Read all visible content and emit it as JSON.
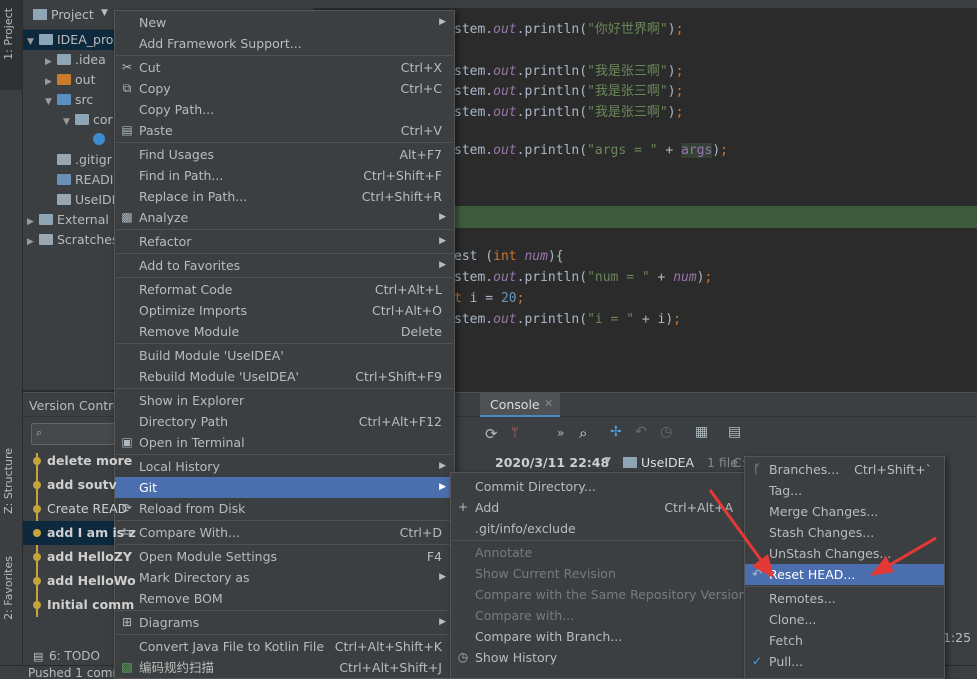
{
  "left_strip": {
    "project_tab": "1: Project",
    "structure_tab": "Z: Structure",
    "favorites_tab": "2: Favorites"
  },
  "project_panel": {
    "title": "Project",
    "tree": [
      {
        "label": "IDEA_pro",
        "depth": 0,
        "expanded": true,
        "type": "module"
      },
      {
        "label": ".idea",
        "depth": 1,
        "expanded": false,
        "type": "folder"
      },
      {
        "label": "out",
        "depth": 1,
        "expanded": false,
        "type": "folder-out"
      },
      {
        "label": "src",
        "depth": 1,
        "expanded": true,
        "type": "folder-src"
      },
      {
        "label": "cor",
        "depth": 2,
        "expanded": true,
        "type": "package"
      },
      {
        "label": "",
        "depth": 3,
        "type": "class"
      },
      {
        "label": ".gitigr",
        "depth": 1,
        "type": "file"
      },
      {
        "label": "READI",
        "depth": 1,
        "type": "md"
      },
      {
        "label": "UseIDE",
        "depth": 1,
        "type": "iml"
      },
      {
        "label": "External L",
        "depth": 0,
        "expanded": false,
        "type": "lib"
      },
      {
        "label": "Scratches",
        "depth": 0,
        "expanded": false,
        "type": "scratch"
      }
    ]
  },
  "editor": {
    "lines": [
      {
        "code": "stem.out.println(\"你好世界啊\");",
        "str": "\"你好世界啊\""
      },
      {
        "code": "stem.out.println(\"我是张三啊\");",
        "str": "\"我是张三啊\""
      },
      {
        "code": "stem.out.println(\"我是张三啊\");",
        "str": "\"我是张三啊\""
      },
      {
        "code": "stem.out.println(\"我是张三啊\");",
        "str": "\"我是张三啊\""
      },
      {
        "code": "stem.out.println(\"args = \" + args);",
        "str": "\"args = \""
      },
      {
        "code": "est (int num){"
      },
      {
        "code": "stem.out.println(\"num = \" + num);",
        "str": "\"num = \""
      },
      {
        "code": "t i = 20;"
      },
      {
        "code": "stem.out.println(\"i = \" + i);",
        "str": "\"i = \""
      }
    ]
  },
  "bottom_panel": {
    "version_control_tab": "Version Contro",
    "console_tab": "Console",
    "search_placeholder": "Q-",
    "date": "2020/3/11 22:48",
    "branch": "UseIDEA",
    "file_count": "1 file",
    "path_hint": "C:\\Wo",
    "time_hint": "1:25",
    "commits": [
      "delete more",
      "add soutv",
      "Create READ",
      "add I am is z",
      "add HelloZY",
      "add HelloWo",
      "Initial comm"
    ],
    "todo_tab": "6: TODO",
    "status": "Pushed 1 comm"
  },
  "context_menu": {
    "items": [
      {
        "label": "New",
        "submenu": true
      },
      {
        "label": "Add Framework Support..."
      },
      {
        "sep": true
      },
      {
        "label": "Cut",
        "shortcut": "Ctrl+X",
        "icon": "cut-icon"
      },
      {
        "label": "Copy",
        "shortcut": "Ctrl+C",
        "icon": "copy-icon"
      },
      {
        "label": "Copy Path..."
      },
      {
        "label": "Paste",
        "shortcut": "Ctrl+V",
        "icon": "paste-icon"
      },
      {
        "sep": true
      },
      {
        "label": "Find Usages",
        "shortcut": "Alt+F7"
      },
      {
        "label": "Find in Path...",
        "shortcut": "Ctrl+Shift+F"
      },
      {
        "label": "Replace in Path...",
        "shortcut": "Ctrl+Shift+R"
      },
      {
        "label": "Analyze",
        "submenu": true,
        "icon": "analyze-icon"
      },
      {
        "sep": true
      },
      {
        "label": "Refactor",
        "submenu": true
      },
      {
        "sep": true
      },
      {
        "label": "Add to Favorites",
        "submenu": true
      },
      {
        "sep": true
      },
      {
        "label": "Reformat Code",
        "shortcut": "Ctrl+Alt+L"
      },
      {
        "label": "Optimize Imports",
        "shortcut": "Ctrl+Alt+O"
      },
      {
        "label": "Remove Module",
        "shortcut": "Delete"
      },
      {
        "sep": true
      },
      {
        "label": "Build Module 'UseIDEA'"
      },
      {
        "label": "Rebuild Module 'UseIDEA'",
        "shortcut": "Ctrl+Shift+F9"
      },
      {
        "sep": true
      },
      {
        "label": "Show in Explorer"
      },
      {
        "label": "Directory Path",
        "shortcut": "Ctrl+Alt+F12"
      },
      {
        "label": "Open in Terminal",
        "icon": "terminal-icon"
      },
      {
        "sep": true
      },
      {
        "label": "Local History",
        "submenu": true
      },
      {
        "label": "Git",
        "submenu": true,
        "active": true
      },
      {
        "label": "Reload from Disk",
        "icon": "reload-icon"
      },
      {
        "sep": true
      },
      {
        "label": "Compare With...",
        "shortcut": "Ctrl+D",
        "icon": "compare-icon"
      },
      {
        "sep": true
      },
      {
        "label": "Open Module Settings",
        "shortcut": "F4"
      },
      {
        "label": "Mark Directory as",
        "submenu": true
      },
      {
        "label": "Remove BOM"
      },
      {
        "sep": true
      },
      {
        "label": "Diagrams",
        "submenu": true,
        "icon": "diagram-icon"
      },
      {
        "sep": true
      },
      {
        "label": "Convert Java File to Kotlin File",
        "shortcut": "Ctrl+Alt+Shift+K"
      },
      {
        "label": "编码规约扫描",
        "shortcut": "Ctrl+Alt+Shift+J",
        "icon": "scan-icon"
      }
    ]
  },
  "git_menu": {
    "items": [
      {
        "label": "Commit Directory..."
      },
      {
        "label": "Add",
        "shortcut": "Ctrl+Alt+A",
        "icon": "plus-icon"
      },
      {
        "label": ".git/info/exclude"
      },
      {
        "sep": true
      },
      {
        "label": "Annotate",
        "disabled": true
      },
      {
        "label": "Show Current Revision",
        "disabled": true
      },
      {
        "label": "Compare with the Same Repository Version",
        "disabled": true
      },
      {
        "label": "Compare with...",
        "disabled": true
      },
      {
        "label": "Compare with Branch..."
      },
      {
        "label": "Show History",
        "icon": "history-icon"
      }
    ]
  },
  "repo_menu": {
    "items": [
      {
        "label": "Branches...",
        "shortcut": "Ctrl+Shift+`",
        "icon": "branch-icon"
      },
      {
        "label": "Tag..."
      },
      {
        "label": "Merge Changes..."
      },
      {
        "label": "Stash Changes..."
      },
      {
        "label": "UnStash Changes..."
      },
      {
        "label": "Reset HEAD...",
        "active": true,
        "icon": "undo-icon"
      },
      {
        "sep": true
      },
      {
        "label": "Remotes..."
      },
      {
        "label": "Clone..."
      },
      {
        "label": "Fetch"
      },
      {
        "label": "Pull...",
        "icon": "pull-icon"
      }
    ]
  },
  "colors": {
    "menu_bg": "#3c3f41",
    "highlight": "#4b6eaf",
    "arrow": "#e53935",
    "editor_bg": "#2b2b2b"
  }
}
